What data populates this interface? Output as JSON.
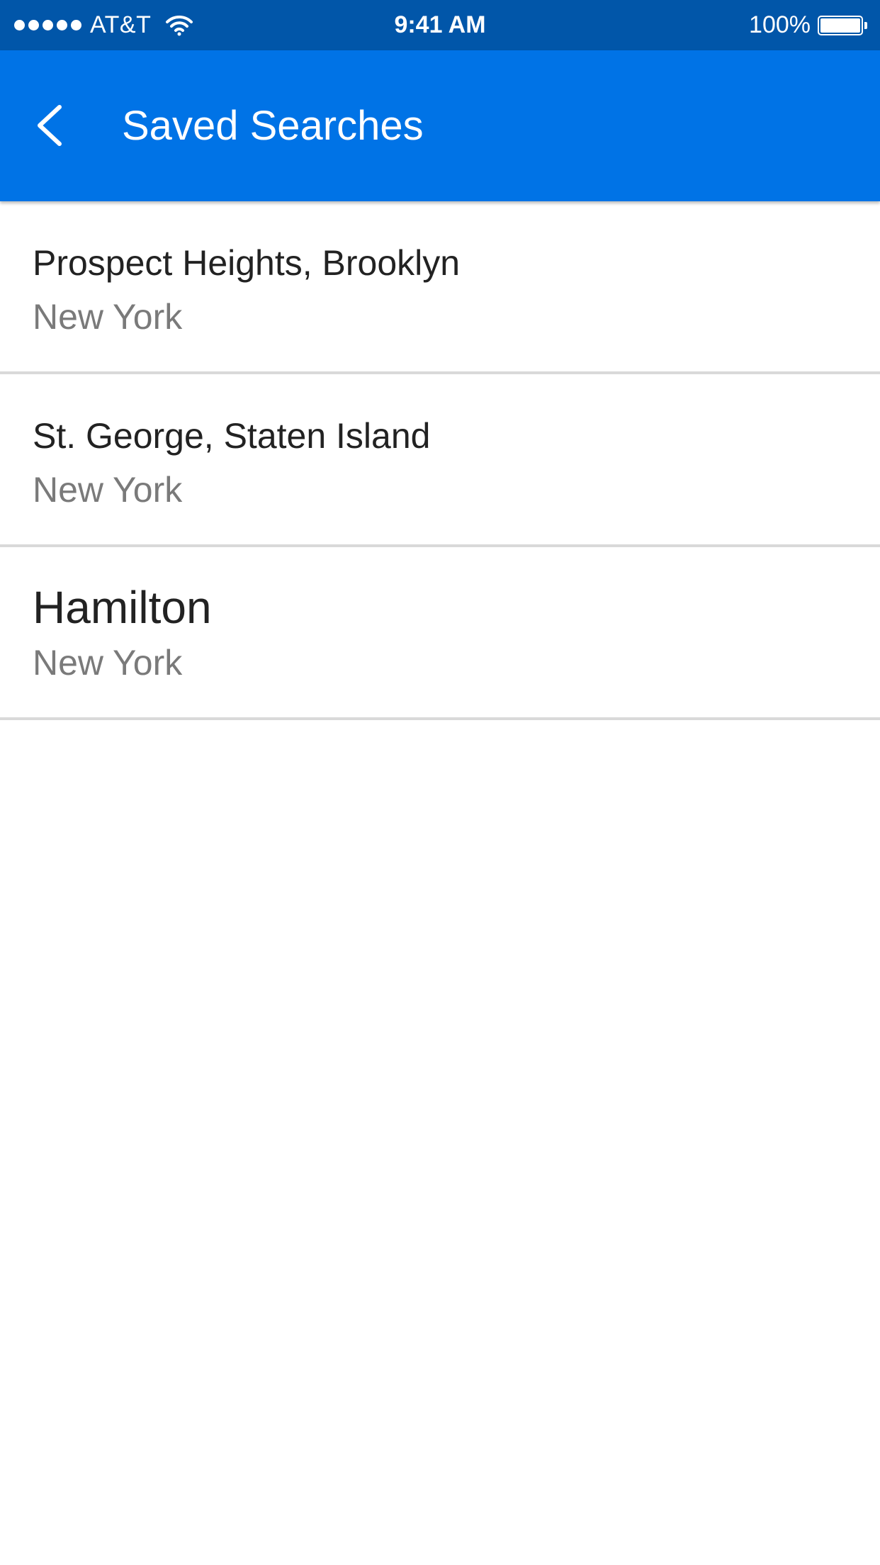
{
  "status_bar": {
    "carrier": "AT&T",
    "signal_icon": "signal-dots-icon",
    "wifi_icon": "wifi-icon",
    "time": "9:41 AM",
    "battery_percent": "100%",
    "battery_level": 1.0,
    "battery_icon": "battery-icon"
  },
  "nav": {
    "back_icon": "chevron-left-icon",
    "title": "Saved Searches"
  },
  "colors": {
    "status_bar": "#0156a9",
    "nav_bar": "#0073e6",
    "title_text": "#222222",
    "subtitle_text": "#7a7a7a",
    "divider": "#d9d9d9"
  },
  "saved_searches": [
    {
      "title": "Prospect Heights, Brooklyn",
      "subtitle": "New York"
    },
    {
      "title": "St. George, Staten Island",
      "subtitle": "New York"
    },
    {
      "title": "Hamilton",
      "subtitle": "New York"
    }
  ]
}
